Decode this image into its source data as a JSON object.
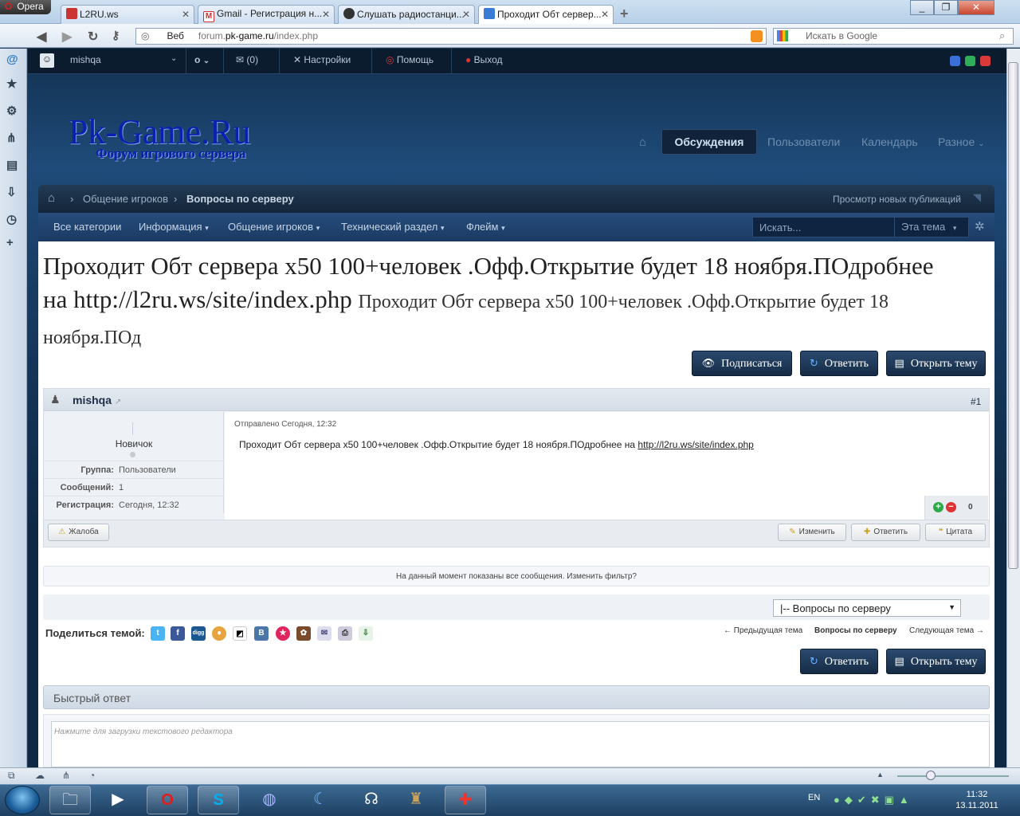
{
  "browser": {
    "menu_label": "Opera",
    "tabs": [
      {
        "label": "L2RU.ws"
      },
      {
        "label": "Gmail - Регистрация н..."
      },
      {
        "label": "Слушать радиостанци..."
      },
      {
        "label": "Проходит Обт сервер..."
      }
    ],
    "web_label": "Веб",
    "url_prefix": "forum.",
    "url_domain": "pk-game.ru",
    "url_path": "/index.php",
    "search_placeholder": "Искать в Google"
  },
  "userbar": {
    "username": "mishqa",
    "counter": "o",
    "messages": "(0)",
    "settings": "Настройки",
    "help": "Помощь",
    "logout": "Выход"
  },
  "site": {
    "logo": "Pk-Game.Ru",
    "subtitle": "Форум игрового сервера"
  },
  "mainnav": {
    "discussions": "Обсуждения",
    "users": "Пользователи",
    "calendar": "Календарь",
    "misc": "Разное"
  },
  "breadcrumb": {
    "item1": "Общение игроков",
    "item2": "Вопросы по серверу",
    "new_posts": "Просмотр новых публикаций"
  },
  "catmenu": {
    "all": "Все категории",
    "info": "Информация",
    "chat": "Общение игроков",
    "tech": "Технический раздел",
    "flame": "Флейм",
    "search_placeholder": "Искать...",
    "search_scope": "Эта тема"
  },
  "topic": {
    "title_big": "Проходит Обт сервера х50 100+человек .Офф.Открытие будет 18 ноября.ПОдробнее на http://l2ru.ws/site/index.php",
    "title_small": "Проходит Обт сервера х50 100+человек .Офф.Открытие будет 18 ноября.ПОд",
    "subscribe": "Подписаться",
    "reply": "Ответить",
    "new_topic": "Открыть тему"
  },
  "post": {
    "author": "mishqa",
    "number": "#1",
    "rank": "Новичок",
    "group_label": "Группа:",
    "group_value": "Пользователи",
    "posts_label": "Сообщений:",
    "posts_value": "1",
    "reg_label": "Регистрация:",
    "reg_value": "Сегодня, 12:32",
    "date": "Отправлено Сегодня, 12:32",
    "text": "Проходит Обт сервера х50 100+человек .Офф.Открытие будет 18 ноября.ПОдробнее на ",
    "link": "http://l2ru.ws/site/index.php",
    "reputation": "0",
    "report": "Жалоба",
    "edit": "Изменить",
    "reply": "Ответить",
    "quote": "Цитата"
  },
  "filter_text": "На данный момент показаны все сообщения. Изменить фильтр?",
  "jump": {
    "selected": "|-- Вопросы по серверу"
  },
  "share": {
    "label": "Поделиться темой:",
    "prev": "← Предыдущая тема",
    "current": "Вопросы по серверу",
    "next": "Следующая тема →"
  },
  "quick_reply": {
    "title": "Быстрый ответ",
    "placeholder": "Нажмите для загрузки текстового редактора"
  },
  "taskbar": {
    "lang": "EN",
    "time": "11:32",
    "date": "13.11.2011"
  }
}
